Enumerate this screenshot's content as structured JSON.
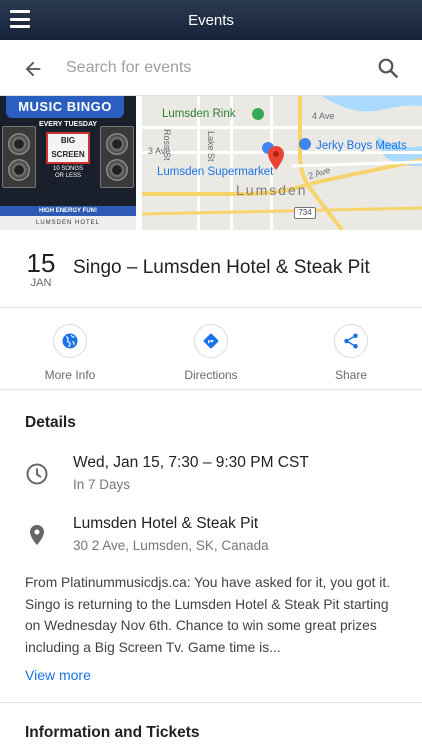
{
  "app_bar": {
    "title": "Events",
    "menu_icon": "hamburger-menu-icon"
  },
  "search": {
    "placeholder": "Search for events",
    "back_icon": "arrow-left-icon",
    "search_icon": "search-icon"
  },
  "poster": {
    "banner": "MUSIC BINGO",
    "tagline_1": "EVERY TUESDAY",
    "tagline_2": "BIG SCREEN",
    "tagline_3": "TV",
    "songs": "10 SONGS OR LESS",
    "energy": "HIGH ENERGY FUN!",
    "venue_strip": "LUMSDEN HOTEL"
  },
  "map": {
    "labels": {
      "rink": "Lumsden Rink",
      "ross": "Ross St",
      "lake": "Lake St",
      "ave3": "3 Ave",
      "ave4": "4 Ave",
      "ave2": "2 Ave",
      "jerky": "Jerky Boys Meats",
      "supermarket": "Lumsden Supermarket",
      "town": "Lumsden",
      "hwy": "734"
    },
    "colors": {
      "park_pin": "#34a853",
      "shop_pin": "#4285f4",
      "event_pin": "#ea4335",
      "road_major": "#f7d36c",
      "water": "#aadaff"
    }
  },
  "event": {
    "day": "15",
    "month": "JAN",
    "title": "Singo – Lumsden Hotel & Steak Pit"
  },
  "actions": [
    {
      "label": "More Info",
      "icon": "globe-icon"
    },
    {
      "label": "Directions",
      "icon": "directions-icon"
    },
    {
      "label": "Share",
      "icon": "share-icon"
    }
  ],
  "details": {
    "heading": "Details",
    "datetime": "Wed, Jan 15, 7:30 – 9:30 PM CST",
    "relative": "In 7 Days",
    "venue": "Lumsden Hotel & Steak Pit",
    "address": "30 2 Ave, Lumsden, SK, Canada",
    "description": "From Platinummusicdjs.ca: You have asked for it, you got it. Singo is returning to the Lumsden Hotel & Steak Pit starting on Wednesday Nov 6th. Chance to win some great prizes including a Big Screen Tv. Game time is...",
    "view_more": "View more"
  },
  "info_tickets": {
    "heading": "Information and Tickets"
  },
  "colors": {
    "app_bar": "#1e2d44",
    "accent": "#1a73e8",
    "icon_blue": "#1a73e8",
    "text": "#212121"
  }
}
